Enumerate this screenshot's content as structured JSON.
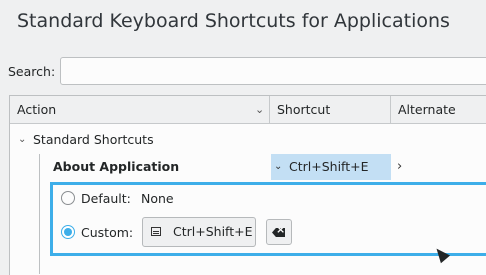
{
  "title": "Standard Keyboard Shortcuts for Applications",
  "search": {
    "label": "Search:",
    "value": "",
    "placeholder": ""
  },
  "table": {
    "columns": [
      "Action",
      "Shortcut",
      "Alternate"
    ],
    "group": {
      "label": "Standard Shortcuts",
      "expanded": true
    },
    "selected_item": {
      "action": "About Application",
      "shortcut": "Ctrl+Shift+E",
      "alternate": ""
    }
  },
  "editor": {
    "default_label": "Default:",
    "default_value": "None",
    "custom_label": "Custom:",
    "custom_value": "Ctrl+Shift+E",
    "selected": "custom"
  },
  "colors": {
    "accent": "#3daee9",
    "selection": "#c3dff4"
  }
}
